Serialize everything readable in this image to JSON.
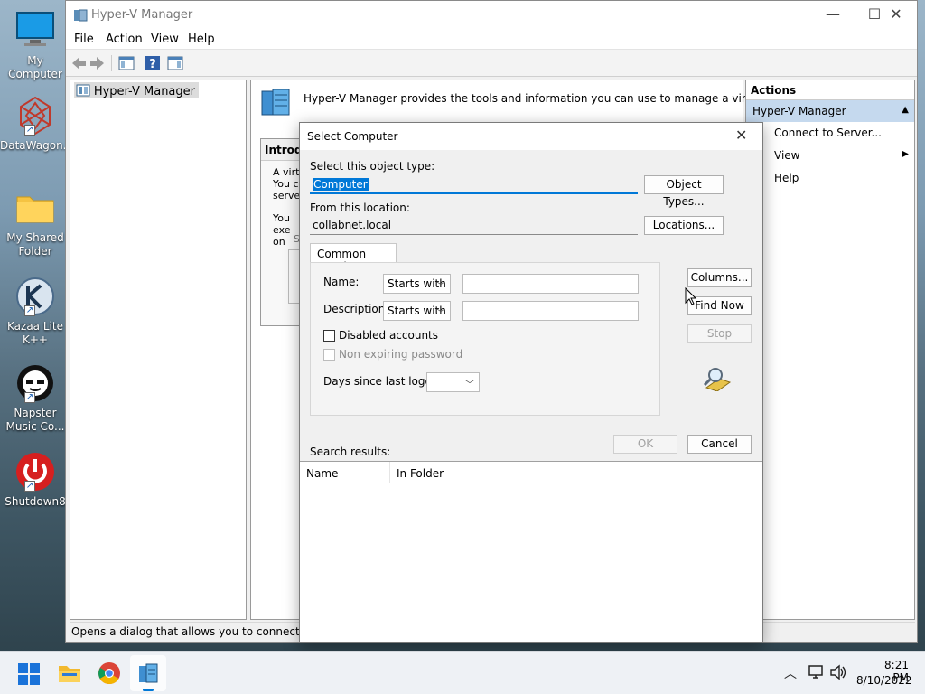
{
  "desktop": {
    "icons": [
      {
        "label": "My Computer",
        "icon": "monitor-icon"
      },
      {
        "label": "DataWagon...",
        "icon": "datawagon-icon"
      },
      {
        "label": "My Shared Folder",
        "icon": "folder-icon"
      },
      {
        "label": "Kazaa Lite K++",
        "icon": "kazaa-icon"
      },
      {
        "label": "Napster Music Co...",
        "icon": "napster-icon"
      },
      {
        "label": "Shutdown8",
        "icon": "power-icon"
      }
    ]
  },
  "window": {
    "title": "Hyper-V Manager",
    "menu": [
      "File",
      "Action",
      "View",
      "Help"
    ],
    "tree_root": "Hyper-V Manager",
    "content_header": "Hyper-V Manager provides the tools and information you can use to manage a virtualization server.",
    "intro_title": "Introdu",
    "intro_lines": [
      "A virtu",
      "You ca",
      "server."
    ],
    "intro_lines2": [
      "You",
      "exe",
      "on"
    ],
    "intro_stub": "S",
    "actions_header": "Actions",
    "actions_group": "Hyper-V Manager",
    "actions_items": [
      "Connect to Server...",
      "View",
      "Help"
    ],
    "status_text": "Opens a dialog that allows you to connect to a s"
  },
  "dialog": {
    "title": "Select Computer",
    "object_type_label": "Select this object type:",
    "object_type_value": "Computer",
    "object_types_button": "Object Types...",
    "location_label": "From this location:",
    "location_value": "collabnet.local",
    "locations_button": "Locations...",
    "tab_label": "Common Queries",
    "name_label": "Name:",
    "name_mode": "Starts with",
    "description_label": "Description:",
    "description_mode": "Starts with",
    "disabled_accounts_label": "Disabled accounts",
    "non_expiring_label": "Non expiring password",
    "days_label": "Days since last logon:",
    "columns_button": "Columns...",
    "find_now_button": "Find Now",
    "stop_button": "Stop",
    "ok_button": "OK",
    "cancel_button": "Cancel",
    "search_results_label": "Search results:",
    "results_columns": [
      "Name",
      "In Folder"
    ]
  },
  "taskbar": {
    "time": "8:21 PM",
    "date": "8/10/2022"
  },
  "colors": {
    "selection": "#0078d7",
    "actions_group_bg": "#c5d9ee"
  }
}
